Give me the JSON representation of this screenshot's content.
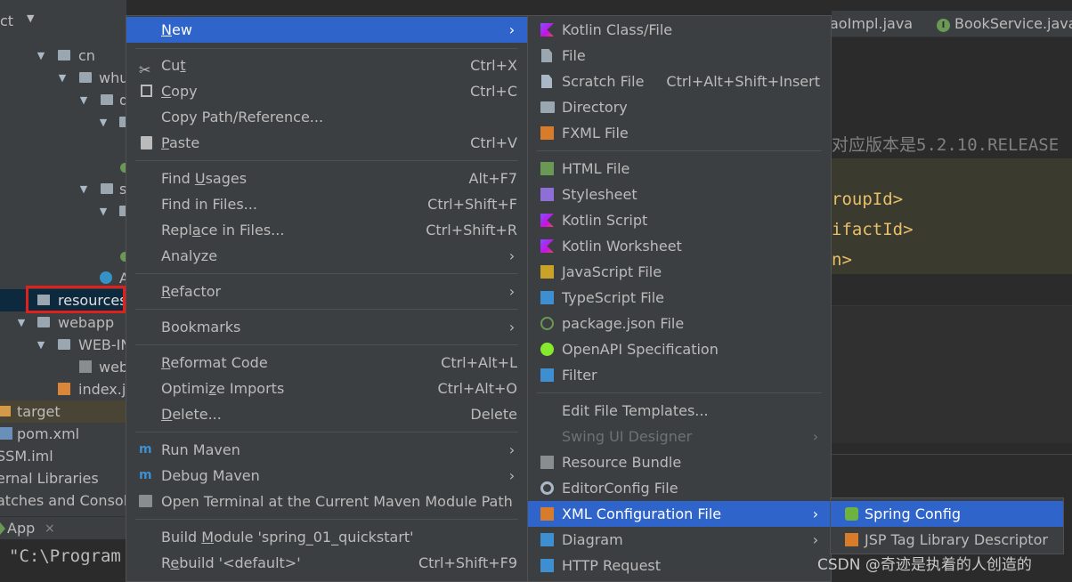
{
  "tree": {
    "header_label": "ct",
    "rows": [
      {
        "label": "cn"
      },
      {
        "label": "whu"
      },
      {
        "label": "d"
      },
      {
        "label": "s"
      },
      {
        "label": "A"
      },
      {
        "label": "resources"
      },
      {
        "label": "webapp"
      },
      {
        "label": "WEB-IN"
      },
      {
        "label": "web"
      },
      {
        "label": "index.js"
      },
      {
        "label": "target"
      },
      {
        "label": "pom.xml"
      },
      {
        "label": "SSM.iml"
      },
      {
        "label": "ernal Libraries"
      },
      {
        "label": "atches and Console"
      }
    ]
  },
  "run": {
    "tab_label": "App",
    "close": "×",
    "console_text": "\"C:\\Program"
  },
  "editor": {
    "tabs": [
      {
        "label": "aoImpl.java"
      },
      {
        "label": "BookService.java",
        "badge": "I"
      }
    ],
    "comment": "对应版本是5.2.10.RELEASE",
    "lines": [
      "roupId>",
      "ifactId>",
      "n>"
    ]
  },
  "context_menu": {
    "items": [
      {
        "label": "New",
        "underline": "N",
        "submenu": true
      },
      {
        "label": "Cut",
        "underline": "t",
        "shortcut": "Ctrl+X",
        "icon": "scissors-icon"
      },
      {
        "label": "Copy",
        "underline": "C",
        "shortcut": "Ctrl+C",
        "icon": "copy-icon"
      },
      {
        "label": "Copy Path/Reference..."
      },
      {
        "label": "Paste",
        "underline": "P",
        "shortcut": "Ctrl+V",
        "icon": "paste-icon"
      },
      {
        "label": "Find Usages",
        "underline": "U",
        "shortcut": "Alt+F7"
      },
      {
        "label": "Find in Files...",
        "shortcut": "Ctrl+Shift+F"
      },
      {
        "label": "Replace in Files...",
        "underline": "a",
        "shortcut": "Ctrl+Shift+R"
      },
      {
        "label": "Analyze",
        "submenu": true
      },
      {
        "label": "Refactor",
        "underline": "R",
        "submenu": true
      },
      {
        "label": "Bookmarks",
        "submenu": true
      },
      {
        "label": "Reformat Code",
        "underline": "R",
        "shortcut": "Ctrl+Alt+L"
      },
      {
        "label": "Optimize Imports",
        "underline": "z",
        "shortcut": "Ctrl+Alt+O"
      },
      {
        "label": "Delete...",
        "underline": "D",
        "shortcut": "Delete"
      },
      {
        "label": "Run Maven",
        "submenu": true,
        "icon": "maven-run-icon"
      },
      {
        "label": "Debug Maven",
        "submenu": true,
        "icon": "maven-debug-icon"
      },
      {
        "label": "Open Terminal at the Current Maven Module Path",
        "icon": "terminal-icon"
      },
      {
        "label": "Build Module 'spring_01_quickstart'",
        "underline": "M"
      },
      {
        "label": "Rebuild '<default>'",
        "underline": "e",
        "shortcut": "Ctrl+Shift+F9"
      }
    ]
  },
  "new_submenu": {
    "items": [
      {
        "label": "Kotlin Class/File",
        "icon": "kotlin-icon"
      },
      {
        "label": "File",
        "icon": "file-icon"
      },
      {
        "label": "Scratch File",
        "shortcut": "Ctrl+Alt+Shift+Insert",
        "icon": "scratch-file-icon"
      },
      {
        "label": "Directory",
        "icon": "folder-icon"
      },
      {
        "label": "FXML File",
        "icon": "fxml-icon"
      },
      {
        "label": "HTML File",
        "icon": "html-icon"
      },
      {
        "label": "Stylesheet",
        "icon": "css-icon"
      },
      {
        "label": "Kotlin Script",
        "icon": "kotlin-script-icon"
      },
      {
        "label": "Kotlin Worksheet",
        "icon": "kotlin-worksheet-icon"
      },
      {
        "label": "JavaScript File",
        "icon": "javascript-icon"
      },
      {
        "label": "TypeScript File",
        "icon": "typescript-icon"
      },
      {
        "label": "package.json File",
        "icon": "json-icon"
      },
      {
        "label": "OpenAPI Specification",
        "icon": "openapi-icon"
      },
      {
        "label": "Filter",
        "icon": "filter-icon"
      },
      {
        "label": "Edit File Templates..."
      },
      {
        "label": "Swing UI Designer",
        "disabled": true,
        "submenu": true
      },
      {
        "label": "Resource Bundle",
        "icon": "resource-bundle-icon"
      },
      {
        "label": "EditorConfig File",
        "icon": "gear-icon"
      },
      {
        "label": "XML Configuration File",
        "submenu": true,
        "selected": true,
        "icon": "xml-config-icon"
      },
      {
        "label": "Diagram",
        "submenu": true,
        "icon": "diagram-icon"
      },
      {
        "label": "HTTP Request",
        "icon": "api-icon"
      }
    ]
  },
  "xml_submenu": {
    "items": [
      {
        "label": "Spring Config",
        "selected": true,
        "icon": "spring-icon"
      },
      {
        "label": "JSP Tag Library Descriptor",
        "icon": "jsp-tld-icon"
      }
    ]
  },
  "watermark": "CSDN @奇迹是执着的人创造的",
  "colors": {
    "menu_bg": "#3c3f41",
    "selection": "#2f65ca",
    "highlight_box": "#e0201a",
    "code_keyword": "#e8bf6a"
  }
}
